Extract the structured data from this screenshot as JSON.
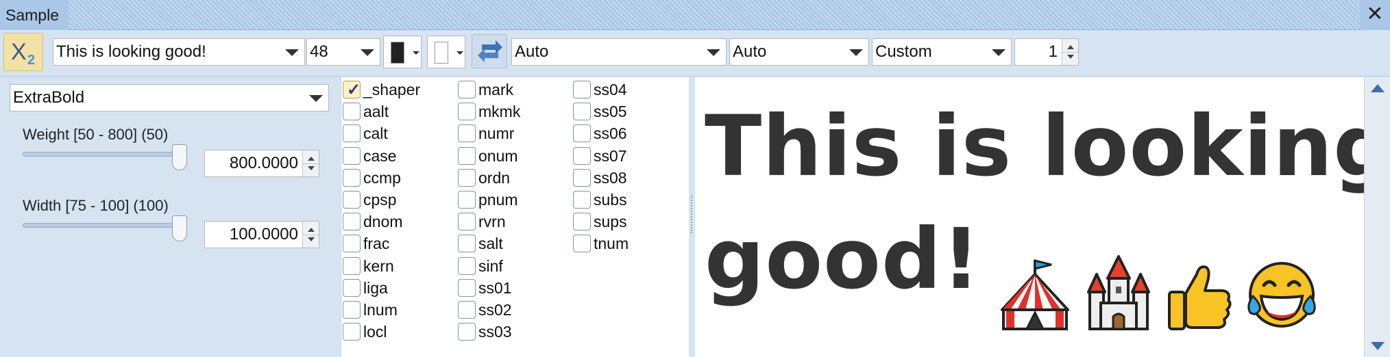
{
  "window": {
    "title": "Sample"
  },
  "toolbar": {
    "sample_text": "This is looking good!",
    "font_size": "48",
    "language": "Auto",
    "script": "Auto",
    "direction": "Custom",
    "lines": "1",
    "fg_color": "#222222",
    "bg_color": "#ffffff"
  },
  "variation": {
    "instance": "ExtraBold",
    "axes": [
      {
        "label": "Weight [50 - 800] (50)",
        "value": "800.0000",
        "min": 50,
        "max": 800,
        "current": 800
      },
      {
        "label": "Width [75 - 100] (100)",
        "value": "100.0000",
        "min": 75,
        "max": 100,
        "current": 100
      }
    ]
  },
  "features": [
    {
      "tag": "_shaper",
      "checked": true
    },
    {
      "tag": "aalt",
      "checked": false
    },
    {
      "tag": "calt",
      "checked": false
    },
    {
      "tag": "case",
      "checked": false
    },
    {
      "tag": "ccmp",
      "checked": false
    },
    {
      "tag": "cpsp",
      "checked": false
    },
    {
      "tag": "dnom",
      "checked": false
    },
    {
      "tag": "frac",
      "checked": false
    },
    {
      "tag": "kern",
      "checked": false
    },
    {
      "tag": "liga",
      "checked": false
    },
    {
      "tag": "lnum",
      "checked": false
    },
    {
      "tag": "locl",
      "checked": false
    },
    {
      "tag": "mark",
      "checked": false
    },
    {
      "tag": "mkmk",
      "checked": false
    },
    {
      "tag": "numr",
      "checked": false
    },
    {
      "tag": "onum",
      "checked": false
    },
    {
      "tag": "ordn",
      "checked": false
    },
    {
      "tag": "pnum",
      "checked": false
    },
    {
      "tag": "rvrn",
      "checked": false
    },
    {
      "tag": "salt",
      "checked": false
    },
    {
      "tag": "sinf",
      "checked": false
    },
    {
      "tag": "ss01",
      "checked": false
    },
    {
      "tag": "ss02",
      "checked": false
    },
    {
      "tag": "ss03",
      "checked": false
    },
    {
      "tag": "ss04",
      "checked": false
    },
    {
      "tag": "ss05",
      "checked": false
    },
    {
      "tag": "ss06",
      "checked": false
    },
    {
      "tag": "ss07",
      "checked": false
    },
    {
      "tag": "ss08",
      "checked": false
    },
    {
      "tag": "subs",
      "checked": false
    },
    {
      "tag": "sups",
      "checked": false
    },
    {
      "tag": "tnum",
      "checked": false
    }
  ],
  "preview": {
    "line1": "This is looking",
    "line2": "good!",
    "emoji": [
      "circus-tent-emoji",
      "castle-emoji",
      "thumbs-up-emoji",
      "tears-of-joy-emoji"
    ]
  }
}
